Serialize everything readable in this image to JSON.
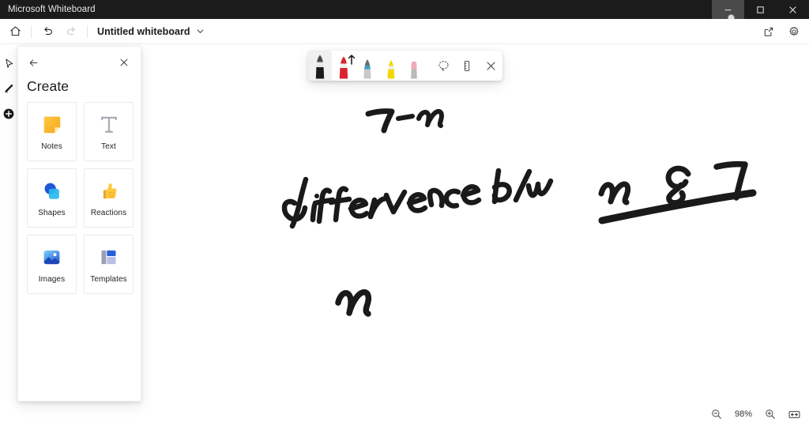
{
  "window": {
    "app_title": "Microsoft Whiteboard",
    "controls": [
      {
        "name": "minimize",
        "glyph": "minimize-icon"
      },
      {
        "name": "maximize",
        "glyph": "maximize-icon"
      },
      {
        "name": "close",
        "glyph": "close-icon"
      }
    ]
  },
  "appbar": {
    "home_label": "Home",
    "undo_label": "Undo",
    "redo_label": "Redo",
    "doc_title": "Untitled whiteboard",
    "share_label": "Share",
    "settings_label": "Settings"
  },
  "rail": {
    "items": [
      {
        "name": "select-tool",
        "label": "Select"
      },
      {
        "name": "ink-tool",
        "label": "Ink"
      },
      {
        "name": "create-tool",
        "label": "Create",
        "active": true
      }
    ]
  },
  "panel": {
    "back_label": "Back",
    "close_label": "Close",
    "title": "Create",
    "cards": [
      {
        "label": "Notes",
        "icon": "sticky-note-icon"
      },
      {
        "label": "Text",
        "icon": "text-t-icon"
      },
      {
        "label": "Shapes",
        "icon": "shapes-icon"
      },
      {
        "label": "Reactions",
        "icon": "thumbs-up-icon"
      },
      {
        "label": "Images",
        "icon": "image-icon"
      },
      {
        "label": "Templates",
        "icon": "templates-icon"
      }
    ]
  },
  "pen_toolbar": {
    "pens": [
      {
        "name": "black-pen",
        "color": "#1a1a1a",
        "selected": true,
        "raised": false
      },
      {
        "name": "red-pen",
        "color": "#d9232e",
        "selected": false,
        "raised": true
      },
      {
        "name": "blue-pen",
        "color": "#3e9fc4",
        "selected": false,
        "raised": false
      },
      {
        "name": "yellow-highlighter",
        "color": "#f2d800",
        "selected": false,
        "raised": false
      }
    ],
    "tools": [
      {
        "name": "eraser",
        "label": "Eraser"
      },
      {
        "name": "lasso-select",
        "label": "Lasso select"
      },
      {
        "name": "ruler",
        "label": "Ruler"
      },
      {
        "name": "close-pen-toolbar",
        "label": "Close"
      }
    ]
  },
  "canvas": {
    "ink_color": "#1a1a1a",
    "strokes": [
      {
        "name": "ink-arrow-n-top",
        "transcript": "7-n"
      },
      {
        "name": "ink-difference-bw",
        "transcript": "difference b/w"
      },
      {
        "name": "ink-n-right",
        "transcript": "n"
      },
      {
        "name": "ink-script-right",
        "transcript": "c7"
      },
      {
        "name": "ink-underline",
        "transcript": "underline"
      },
      {
        "name": "ink-n-bottom",
        "transcript": "n"
      }
    ]
  },
  "zoom": {
    "zoom_out_label": "Zoom out",
    "level": "98%",
    "zoom_in_label": "Zoom in",
    "fit_label": "Fit to screen"
  }
}
